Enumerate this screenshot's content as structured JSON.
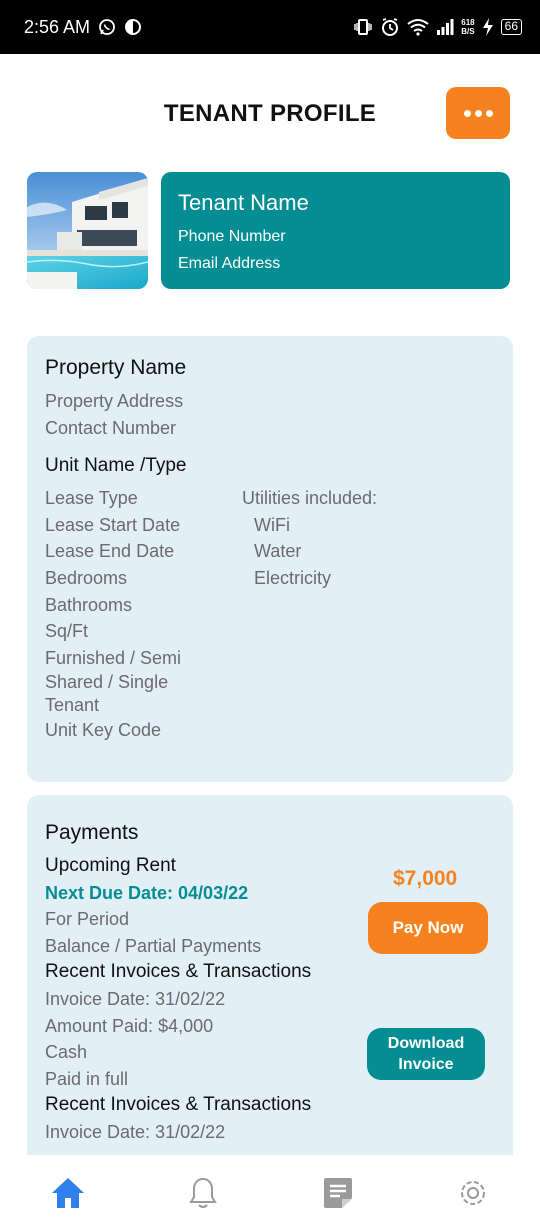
{
  "status_bar": {
    "time": "2:56 AM",
    "net_speed_top": "618",
    "net_speed_bottom": "B/S",
    "battery": "66"
  },
  "header": {
    "title": "TENANT PROFILE"
  },
  "tenant": {
    "name": "Tenant Name",
    "phone": "Phone Number",
    "email": "Email Address"
  },
  "property": {
    "name": "Property Name",
    "address": "Property Address",
    "contact": "Contact Number",
    "unit_title": "Unit Name /Type",
    "details": [
      "Lease Type",
      "Lease Start Date",
      "Lease End Date",
      "Bedrooms",
      "Bathrooms",
      "Sq/Ft",
      "Furnished / Semi",
      "Shared / Single Tenant",
      "Unit Key Code"
    ],
    "utilities_title": "Utilities included:",
    "utilities": [
      "WiFi",
      "Water",
      "Electricity"
    ]
  },
  "payments": {
    "title": "Payments",
    "upcoming": "Upcoming Rent",
    "next_due": "Next Due Date: 04/03/22",
    "period": "For Period",
    "balance": "Balance / Partial Payments",
    "amount": "$7,000",
    "pay_button": "Pay Now",
    "recent_title": "Recent Invoices & Transactions",
    "invoice_date": "Invoice Date: 31/02/22",
    "amount_paid": "Amount Paid: $4,000",
    "method": "Cash",
    "status": "Paid in full",
    "download_button": "Download Invoice",
    "recent_title_2": "Recent Invoices & Transactions",
    "invoice_date_2": "Invoice Date: 31/02/22"
  },
  "nav": {
    "icons": [
      "home-icon",
      "bell-icon",
      "notes-icon",
      "settings-icon"
    ],
    "active_color": "#2F80ED",
    "inactive_color": "#9a9a9a"
  },
  "colors": {
    "accent_orange": "#F5821F",
    "teal": "#048E93",
    "card_bg": "#E2EFF6"
  }
}
